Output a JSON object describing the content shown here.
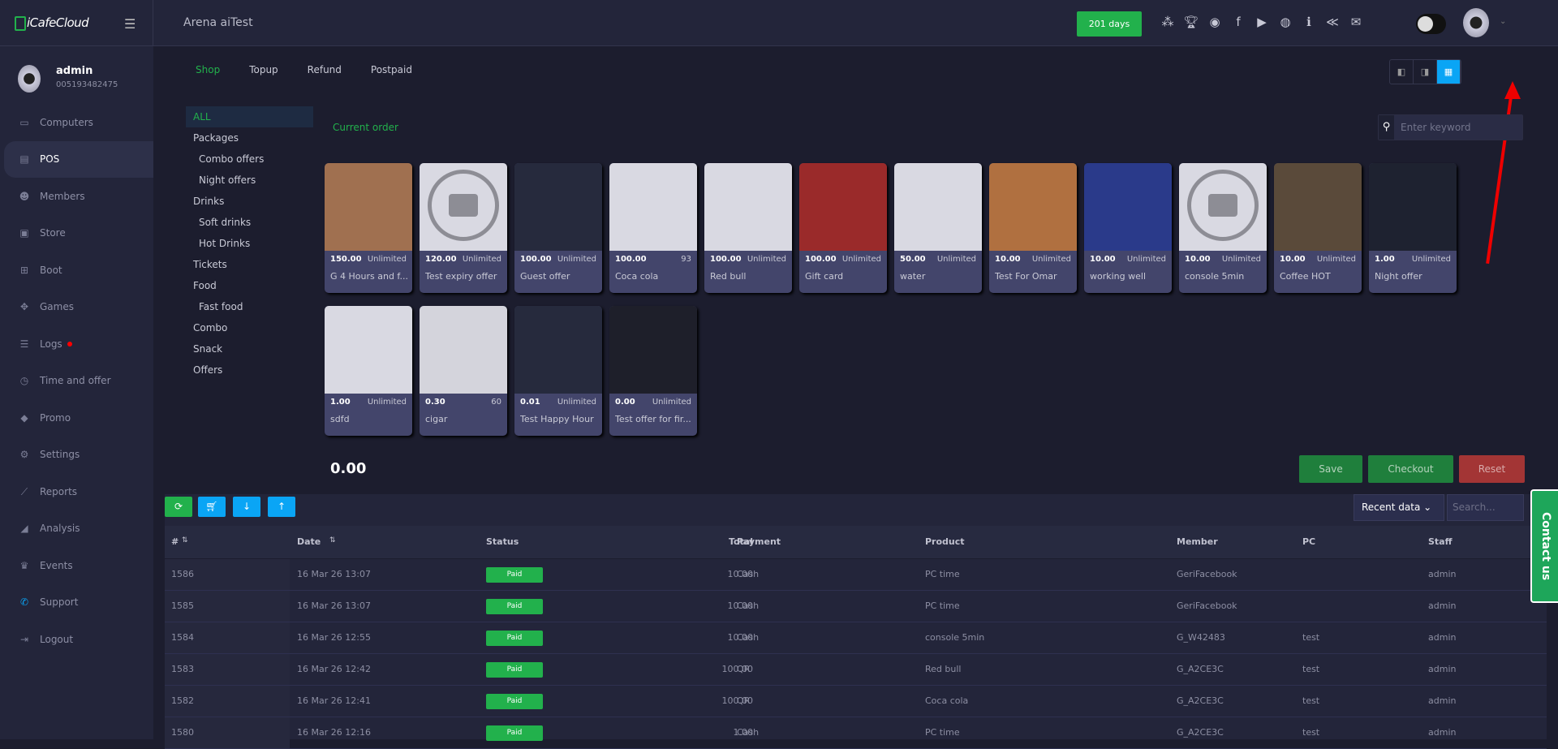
{
  "brand": {
    "name": "iCafeCloud"
  },
  "header": {
    "arena": "Arena aiTest",
    "days": "201 days",
    "icons": [
      "leaderboard-icon",
      "trophy-icon",
      "rss-icon",
      "facebook-icon",
      "youtube-icon",
      "globe-icon",
      "icafe-icon",
      "partner-icon",
      "mail-icon"
    ]
  },
  "user": {
    "name": "admin",
    "id": "005193482475"
  },
  "nav": [
    {
      "label": "Computers",
      "icon": "▭"
    },
    {
      "label": "POS",
      "icon": "▤",
      "active": true
    },
    {
      "label": "Members",
      "icon": "☻"
    },
    {
      "label": "Store",
      "icon": "▣"
    },
    {
      "label": "Boot",
      "icon": "⊞"
    },
    {
      "label": "Games",
      "icon": "✥"
    },
    {
      "label": "Logs",
      "icon": "☰",
      "dot": true
    },
    {
      "label": "Time and offer",
      "icon": "◷"
    },
    {
      "label": "Promo",
      "icon": "◆"
    },
    {
      "label": "Settings",
      "icon": "⚙"
    },
    {
      "label": "Reports",
      "icon": "⟋"
    },
    {
      "label": "Analysis",
      "icon": "◢"
    },
    {
      "label": "Events",
      "icon": "♛"
    },
    {
      "label": "Support",
      "icon": "✆"
    },
    {
      "label": "Logout",
      "icon": "⇥"
    }
  ],
  "tabs": [
    {
      "label": "Shop",
      "active": true
    },
    {
      "label": "Topup"
    },
    {
      "label": "Refund"
    },
    {
      "label": "Postpaid"
    }
  ],
  "categories": [
    {
      "label": "ALL",
      "active": true
    },
    {
      "label": "Packages"
    },
    {
      "label": "Combo offers",
      "sub": true
    },
    {
      "label": "Night offers",
      "sub": true
    },
    {
      "label": "Drinks"
    },
    {
      "label": "Soft drinks",
      "sub": true
    },
    {
      "label": "Hot Drinks",
      "sub": true
    },
    {
      "label": "Tickets"
    },
    {
      "label": "Food"
    },
    {
      "label": "Fast food",
      "sub": true
    },
    {
      "label": "Combo"
    },
    {
      "label": "Snack"
    },
    {
      "label": "Offers"
    }
  ],
  "current_order": "Current order",
  "search": {
    "placeholder": "Enter keyword"
  },
  "products": [
    {
      "price": "150.00",
      "stock": "Unlimited",
      "name": "G 4 Hours and f...",
      "bg": "#a07050"
    },
    {
      "price": "120.00",
      "stock": "Unlimited",
      "name": "Test expiry offer",
      "bg": "#d9d9e2",
      "ph": true
    },
    {
      "price": "100.00",
      "stock": "Unlimited",
      "name": "Guest offer",
      "bg": "#262a3d"
    },
    {
      "price": "100.00",
      "stock": "93",
      "name": "Coca cola",
      "bg": "#d9d9e2"
    },
    {
      "price": "100.00",
      "stock": "Unlimited",
      "name": "Red bull",
      "bg": "#d9d9e2"
    },
    {
      "price": "100.00",
      "stock": "Unlimited",
      "name": "Gift card",
      "bg": "#9a2a2a"
    },
    {
      "price": "50.00",
      "stock": "Unlimited",
      "name": "water",
      "bg": "#d9d9e2"
    },
    {
      "price": "10.00",
      "stock": "Unlimited",
      "name": "Test For Omar",
      "bg": "#b07040"
    },
    {
      "price": "10.00",
      "stock": "Unlimited",
      "name": "working well",
      "bg": "#2a3a8a"
    },
    {
      "price": "10.00",
      "stock": "Unlimited",
      "name": "console 5min",
      "bg": "#d9d9e2",
      "ph": true
    },
    {
      "price": "10.00",
      "stock": "Unlimited",
      "name": "Coffee HOT",
      "bg": "#5a4a3a"
    },
    {
      "price": "1.00",
      "stock": "Unlimited",
      "name": "Night offer",
      "bg": "#1e2230"
    },
    {
      "price": "1.00",
      "stock": "Unlimited",
      "name": "sdfd",
      "bg": "#d9d9e2"
    },
    {
      "price": "0.30",
      "stock": "60",
      "name": "cigar",
      "bg": "#d4d4dc"
    },
    {
      "price": "0.01",
      "stock": "Unlimited",
      "name": "Test Happy Hour",
      "bg": "#262a3d"
    },
    {
      "price": "0.00",
      "stock": "Unlimited",
      "name": "Test offer for fir...",
      "bg": "#1e1f2a"
    }
  ],
  "order_total": "0.00",
  "actions": {
    "save": "Save",
    "checkout": "Checkout",
    "reset": "Reset"
  },
  "table": {
    "filter": "Recent data",
    "search_placeholder": "Search...",
    "columns": [
      "#",
      "Date",
      "Status",
      "Total",
      "Payment",
      "Product",
      "Member",
      "PC",
      "Staff"
    ],
    "rows": [
      [
        "1586",
        "16 Mar 26 13:07",
        "Paid",
        "10.00",
        "Cash",
        "PC time",
        "GeriFacebook",
        "",
        "admin"
      ],
      [
        "1585",
        "16 Mar 26 13:07",
        "Paid",
        "10.00",
        "Cash",
        "PC time",
        "GeriFacebook",
        "",
        "admin"
      ],
      [
        "1584",
        "16 Mar 26 12:55",
        "Paid",
        "10.00",
        "Cash",
        "console 5min",
        "G_W42483",
        "test",
        "admin"
      ],
      [
        "1583",
        "16 Mar 26 12:42",
        "Paid",
        "100.00",
        "QR",
        "Red bull",
        "G_A2CE3C",
        "test",
        "admin"
      ],
      [
        "1582",
        "16 Mar 26 12:41",
        "Paid",
        "100.00",
        "QR",
        "Coca cola",
        "G_A2CE3C",
        "test",
        "admin"
      ],
      [
        "1580",
        "16 Mar 26 12:16",
        "Paid",
        "1.00",
        "Cash",
        "PC time",
        "G_A2CE3C",
        "test",
        "admin"
      ]
    ]
  },
  "contact": "Contact us"
}
